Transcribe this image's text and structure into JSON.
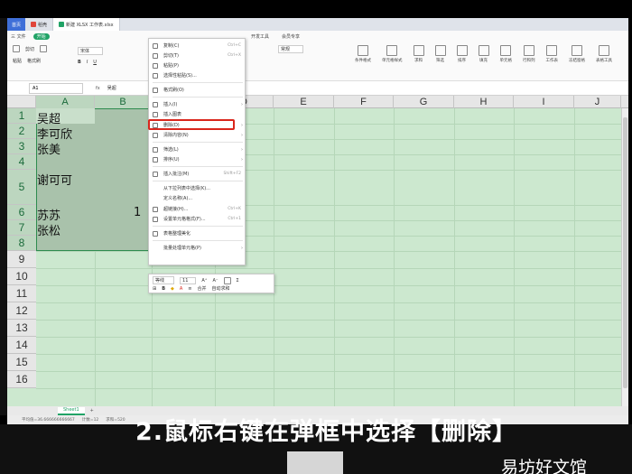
{
  "titlebar": {
    "home": "首页",
    "tab1": "稻壳",
    "tab2": "新建 XLSX 工作表.xlsx"
  },
  "menubar": {
    "file": "三 文件",
    "start": "开始",
    "devtools": "开发工具",
    "member": "会员专享"
  },
  "ribbon": {
    "paste": "粘贴",
    "cut": "剪切",
    "format_painter": "格式刷",
    "font": "宋体",
    "style": "常规",
    "cond_format": "条件格式",
    "cell_style": "单元格样式",
    "sum": "求和",
    "filter": "筛选",
    "sort": "排序",
    "fill": "填充",
    "cell": "单元格",
    "row_col": "行和列",
    "worksheet": "工作表",
    "freeze": "冻结窗格",
    "table_tools": "表格工具"
  },
  "formula": {
    "name_box": "A1",
    "fx": "fx",
    "value": "吴超"
  },
  "columns": [
    "A",
    "B",
    "C",
    "D",
    "E",
    "F",
    "G",
    "H",
    "I",
    "J"
  ],
  "rows": [
    "1",
    "2",
    "3",
    "4",
    "5",
    "6",
    "7",
    "8",
    "9",
    "10",
    "11",
    "12",
    "13",
    "14",
    "15",
    "16"
  ],
  "cells": {
    "a1": "吴超",
    "a2": "李可欣",
    "a3": "张美",
    "a5": "谢可可",
    "a7": "苏苏",
    "a8": "张松",
    "b7": "1"
  },
  "context_menu": {
    "copy": "复制(C)",
    "copy_sc": "Ctrl+C",
    "cut": "剪切(T)",
    "cut_sc": "Ctrl+X",
    "paste": "粘贴(P)",
    "paste_special": "选择性粘贴(S)...",
    "format_painter": "格式刷(O)",
    "insert": "插入(I)",
    "insert_chart": "插入图表",
    "delete": "删除(D)",
    "clear": "清除内容(N)",
    "filter": "筛选(L)",
    "sort": "排序(U)",
    "insert_comment": "插入批注(M)",
    "comment_sc": "Shift+F2",
    "pick_list": "从下拉列表中选择(K)...",
    "define_name": "定义名称(A)...",
    "hyperlink": "超链接(H)...",
    "hyperlink_sc": "Ctrl+K",
    "format_cells": "设置单元格格式(F)...",
    "format_sc": "Ctrl+1",
    "table_beautify": "表格整理美化",
    "table_batch": "批量处理单元格(P)"
  },
  "mini_toolbar": {
    "font": "等线",
    "size": "11",
    "merge": "合并",
    "autosum": "自动求和"
  },
  "sheet": {
    "name": "Sheet1",
    "add": "+"
  },
  "status": {
    "avg": "平均值=36.666666666667",
    "count": "计数=12",
    "sum": "求和=520"
  },
  "caption": "2.鼠标右键在弹框中选择【删除】",
  "watermark": "易坊好文馆"
}
